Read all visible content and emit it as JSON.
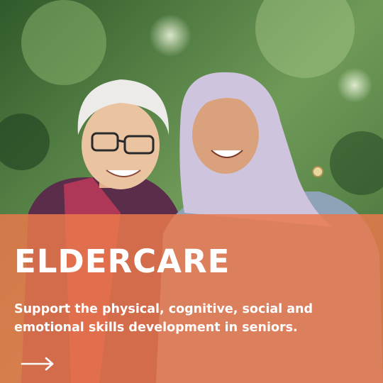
{
  "card": {
    "title": "ELDERCARE",
    "description": "Support the physical, cognitive, social and emotional skills development in seniors.",
    "link_icon": "arrow-right-icon",
    "overlay_color": "#EB784B",
    "text_color": "#FFFFFF"
  }
}
